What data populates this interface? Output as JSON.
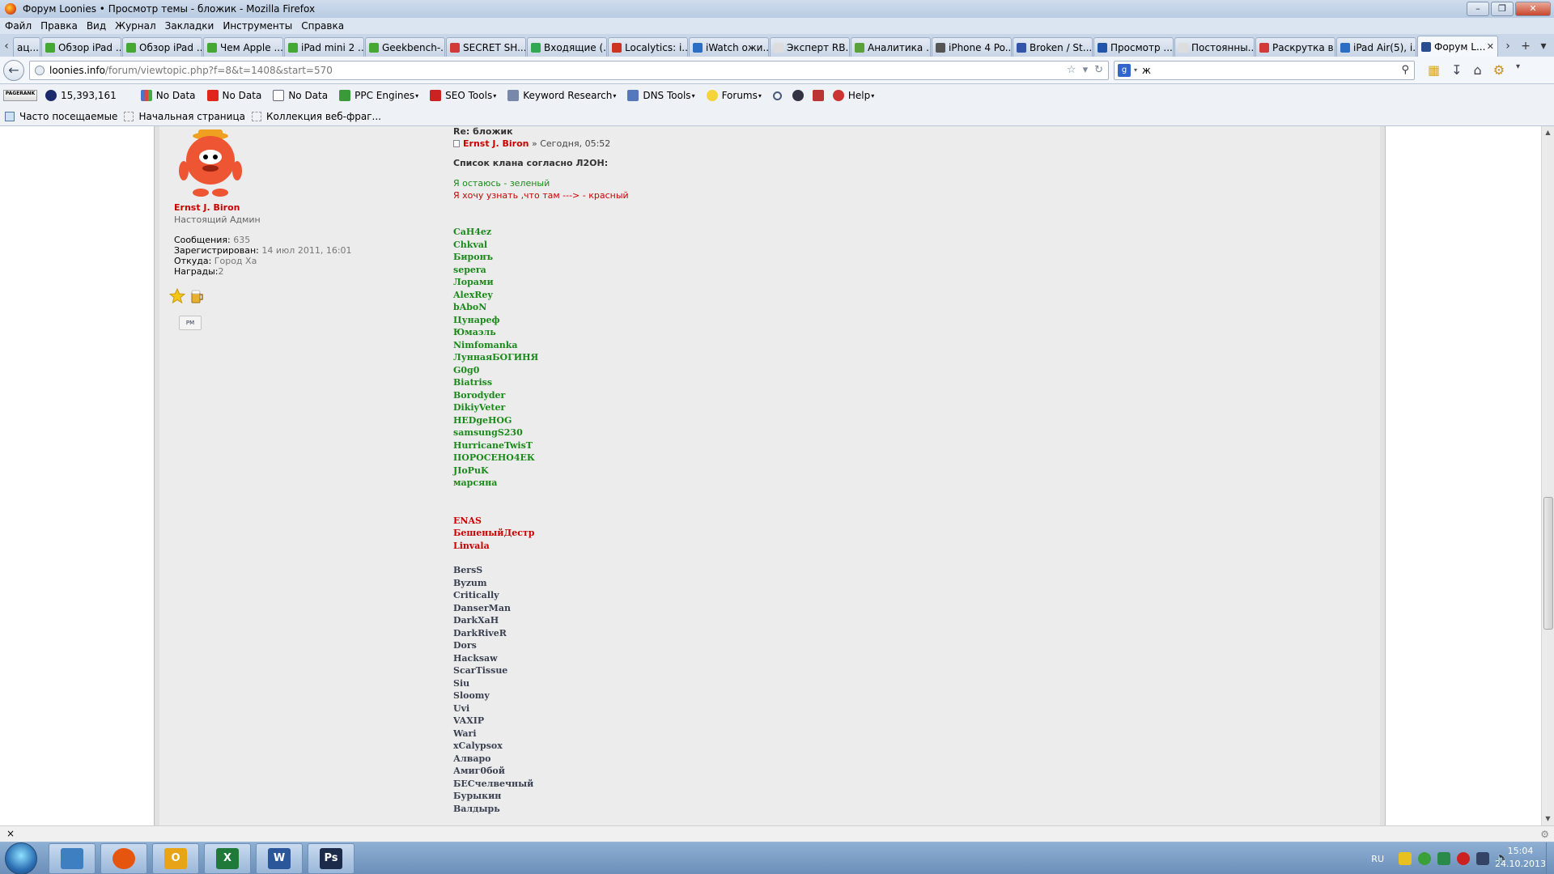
{
  "window": {
    "title": "Форум Loonies • Просмотр темы - бложик - Mozilla Firefox"
  },
  "menu": [
    "Файл",
    "Правка",
    "Вид",
    "Журнал",
    "Закладки",
    "Инструменты",
    "Справка"
  ],
  "tabs": [
    {
      "label": "ац...",
      "color": "#cccccc"
    },
    {
      "label": "Обзор iPad ...",
      "color": "#44a832"
    },
    {
      "label": "Обзор iPad ...",
      "color": "#44a832"
    },
    {
      "label": "Чем Apple ...",
      "color": "#44a832"
    },
    {
      "label": "iPad mini 2 ...",
      "color": "#44a832"
    },
    {
      "label": "Geekbench-...",
      "color": "#44a832"
    },
    {
      "label": "SECRET SH...",
      "color": "#d23a3a"
    },
    {
      "label": "Входящие (...",
      "color": "#33a852"
    },
    {
      "label": "Localytics: i...",
      "color": "#cc3322"
    },
    {
      "label": "iWatch ожи...",
      "color": "#2a6fc4"
    },
    {
      "label": "Эксперт RB...",
      "color": "#dddddd"
    },
    {
      "label": "Аналитика ...",
      "color": "#5ba03a"
    },
    {
      "label": "iPhone 4 Po...",
      "color": "#555555"
    },
    {
      "label": "Broken / St...",
      "color": "#3355aa"
    },
    {
      "label": "Просмотр ...",
      "color": "#2255aa"
    },
    {
      "label": "Постоянны...",
      "color": "#dddddd"
    },
    {
      "label": "Раскрутка в...",
      "color": "#d23a3a"
    },
    {
      "label": "iPad Air(5), i...",
      "color": "#2a6fc4"
    },
    {
      "label": "Форум L...",
      "color": "#2a4d8f",
      "active": true
    }
  ],
  "nav": {
    "url_host": "loonies.info",
    "url_path": "/forum/viewtopic.php?f=8&t=1408&start=570",
    "search_value": "ж"
  },
  "seo": {
    "alexa": "15,393,161",
    "nodata1": "No Data",
    "nodata2": "No Data",
    "nodata3": "No Data",
    "ppc": "PPC Engines",
    "seotools": "SEO Tools",
    "keyword": "Keyword Research",
    "dns": "DNS Tools",
    "forums": "Forums",
    "help": "Help",
    "pagerank_label": "PAGERANK"
  },
  "bookmarks": [
    "Часто посещаемые",
    "Начальная страница",
    "Коллекция веб-фраг..."
  ],
  "profile": {
    "username": "Ernst J. Biron",
    "rank": "Настоящий Админ",
    "posts_label": "Сообщения:",
    "posts": "635",
    "registered_label": "Зарегистрирован:",
    "registered": "14 июл 2011, 16:01",
    "from_label": "Откуда:",
    "from": "Город Ха",
    "awards_label": "Награды:",
    "awards": "2",
    "pm": "PM"
  },
  "post": {
    "title": "Re: бложик",
    "author": "Ernst J. Biron",
    "sep": "»",
    "time": "Сегодня, 05:52",
    "heading": "Список клана согласно Л2ОН:",
    "legend_green": "Я остаюсь - зеленый",
    "legend_red": "Я хочу узнать ,что там ---> - красный",
    "green_names": [
      "CaH4ez",
      "Chkval",
      "Биронъ",
      "sepera",
      "Лорами",
      "AlexRey",
      "bAboN",
      "Цунареф",
      "Юмаэль",
      "Nimfomanka",
      "ЛуннаяБОГИНЯ",
      "G0g0",
      "Biatriss",
      "Borodyder",
      "DikiyVeter",
      "HEDgeHOG",
      "samsungS230",
      "HurricaneTwisT",
      "IIOРОСЕНО4ЕК",
      "JIoPuK",
      "марсяна"
    ],
    "red_names": [
      "ENAS",
      "БешеныйДестр",
      "Linvala"
    ],
    "dark_names": [
      "BersS",
      "Byzum",
      "Critically",
      "DanserMan",
      "DarkXaH",
      "DarkRiveR",
      "Dors",
      "Hacksaw",
      "ScarTissue",
      "Siu",
      "Sloomy",
      "Uvi",
      "VAXIP",
      "Wari",
      "xCalypsox",
      "Алваро",
      "Амиг0бой",
      "БЕСчелвечный",
      "Бурыкин",
      "Валдырь"
    ]
  },
  "findbar": {
    "close": "×"
  },
  "taskbar": {
    "apps": [
      {
        "name": "explorer",
        "label": "",
        "color": "#3d7fc1"
      },
      {
        "name": "firefox",
        "label": "",
        "color": "#e6550d"
      },
      {
        "name": "outlook",
        "label": "O",
        "color": "#e8a317"
      },
      {
        "name": "excel",
        "label": "X",
        "color": "#1f7a3a"
      },
      {
        "name": "word",
        "label": "W",
        "color": "#2b579a"
      },
      {
        "name": "photoshop",
        "label": "Ps",
        "color": "#1c2b4a"
      }
    ],
    "lang": "RU",
    "time": "15:04",
    "date": "24.10.2013"
  }
}
